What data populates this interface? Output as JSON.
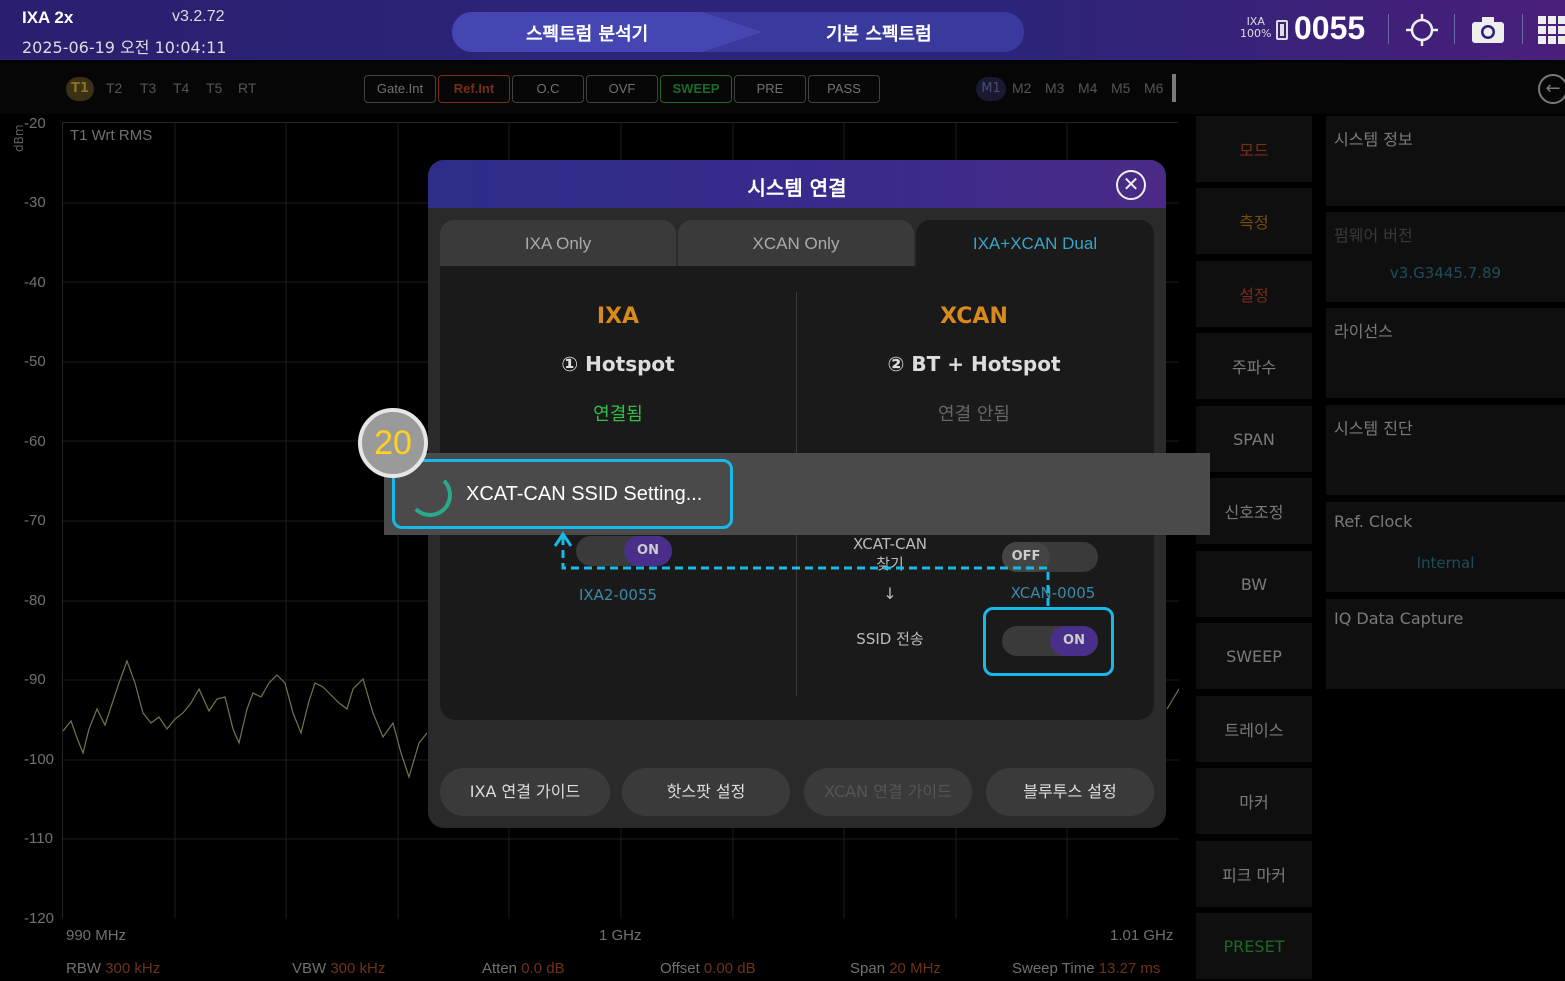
{
  "header": {
    "app_title": "IXA 2x",
    "version": "v3.2.72",
    "datetime": "2025-06-19 오전 10:04:11",
    "mode_primary": "스펙트럼 분석기",
    "mode_secondary": "기본 스펙트럼",
    "status_label": "IXA",
    "battery_percent": "100%",
    "device_number": "0055"
  },
  "traces": [
    "T1",
    "T2",
    "T3",
    "T4",
    "T5",
    "RT"
  ],
  "status_buttons": [
    "Gate.Int",
    "Ref.Int",
    "O.C",
    "OVF",
    "SWEEP",
    "PRE",
    "PASS"
  ],
  "status_colors": {
    "Ref.Int": "#d9522a",
    "SWEEP": "#2fbf4a"
  },
  "markers": [
    "M1",
    "M2",
    "M3",
    "M4",
    "M5",
    "M6"
  ],
  "plot": {
    "y_unit": "dBm",
    "trace_label": "T1 Wrt RMS",
    "y_ticks": [
      "-20",
      "-30",
      "-40",
      "-50",
      "-60",
      "-70",
      "-80",
      "-90",
      "-100",
      "-110",
      "-120"
    ],
    "x_start": "990 MHz",
    "x_center": "1 GHz",
    "x_stop": "1.01 GHz",
    "trace_color": "#d8d48a"
  },
  "bottom": {
    "rbw_label": "RBW",
    "rbw_value": "300 kHz",
    "vbw_label": "VBW",
    "vbw_value": "300 kHz",
    "atten_label": "Atten",
    "atten_value": "0.0 dB",
    "offset_label": "Offset",
    "offset_value": "0.00 dB",
    "span_label": "Span",
    "span_value": "20 MHz",
    "sweep_label": "Sweep Time",
    "sweep_value": "13.27 ms"
  },
  "menu": [
    "모드",
    "측정",
    "설정",
    "주파수",
    "SPAN",
    "신호조정",
    "BW",
    "SWEEP",
    "트레이스",
    "마커",
    "피크 마커",
    "PRESET"
  ],
  "info": {
    "system_info": "시스템 정보",
    "firmware_label": "펌웨어 버전",
    "firmware_value": "v3.G3445.7.89",
    "license": "라이선스",
    "diagnosis": "시스템 진단",
    "ref_clock": "Ref. Clock",
    "ref_clock_value": "Internal",
    "iq_capture": "IQ Data Capture"
  },
  "dialog": {
    "title": "시스템 연결",
    "tabs": [
      "IXA Only",
      "XCAN Only",
      "IXA+XCAN Dual"
    ],
    "left": {
      "name": "IXA",
      "method": "① Hotspot",
      "status": "연결됨",
      "toggle": "ON",
      "ssid": "IXA2-0055"
    },
    "right": {
      "name": "XCAN",
      "method": "② BT + Hotspot",
      "status": "연결 안됨",
      "find_label": "XCAT-CAN\n찾기",
      "find_line1": "XCAT-CAN",
      "find_line2": "찾기",
      "arrow": "↓",
      "ssid_send": "SSID 전송",
      "find_toggle": "OFF",
      "device": "XCAN-0005",
      "send_toggle": "ON"
    },
    "buttons": [
      "IXA 연결 가이드",
      "핫스팟 설정",
      "XCAN 연결 가이드",
      "블루투스 설정"
    ]
  },
  "toast": {
    "text": "XCAT-CAN SSID Setting..."
  },
  "annotation": {
    "step": "20"
  },
  "colors": {
    "accent": "#1ab8e8",
    "orange": "#d98a1c",
    "connected": "#2fbf4a",
    "disabled": "#3a8aa8"
  }
}
